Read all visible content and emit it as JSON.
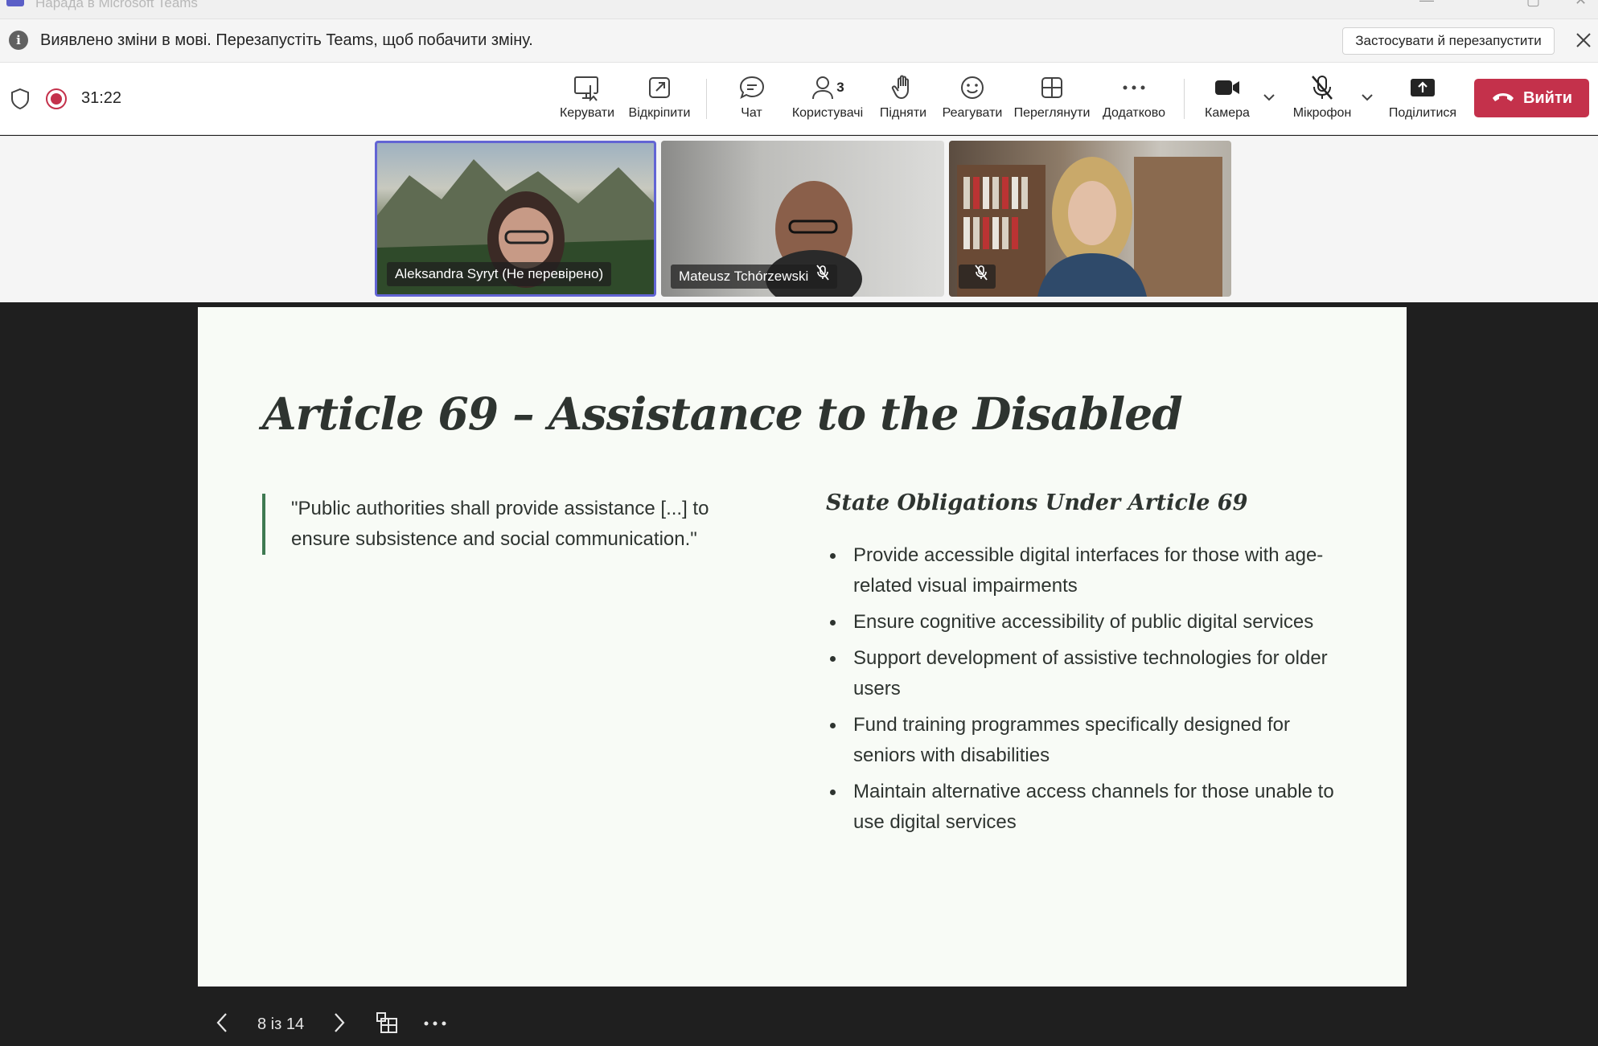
{
  "window": {
    "title": "Нарада в Microsoft Teams"
  },
  "notification": {
    "message": "Виявлено зміни в мові. Перезапустіть Teams, щоб побачити зміну.",
    "apply_label": "Застосувати й перезапустити"
  },
  "meeting": {
    "timer": "31:22"
  },
  "toolbar": {
    "control_label": "Керувати",
    "popout_label": "Відкріпити",
    "chat_label": "Чат",
    "people_label": "Користувачі",
    "people_count": "3",
    "raise_label": "Підняти",
    "react_label": "Реагувати",
    "view_label": "Переглянути",
    "more_label": "Додатково",
    "camera_label": "Камера",
    "mic_label": "Мікрофон",
    "share_label": "Поділитися",
    "leave_label": "Вийти"
  },
  "participants": [
    {
      "name": "Aleksandra Syryt (Не перевірено)",
      "muted": false,
      "active": true
    },
    {
      "name": "Mateusz Tchórzewski",
      "muted": true,
      "active": false
    },
    {
      "name": "",
      "muted": true,
      "active": false
    }
  ],
  "slide": {
    "title": "Article 69 – Assistance to the Disabled",
    "quote": "\"Public authorities shall provide assistance [...] to ensure subsistence and social communication.\"",
    "obligations_title": "State Obligations Under Article 69",
    "obligations": [
      "Provide accessible digital interfaces for those with age-related visual impairments",
      "Ensure cognitive accessibility of public digital services",
      "Support development of assistive technologies for older users",
      "Fund training programmes specifically designed for seniors with disabilities",
      "Maintain alternative access channels for those unable to use digital services"
    ]
  },
  "slide_nav": {
    "page": "8 із 14"
  }
}
